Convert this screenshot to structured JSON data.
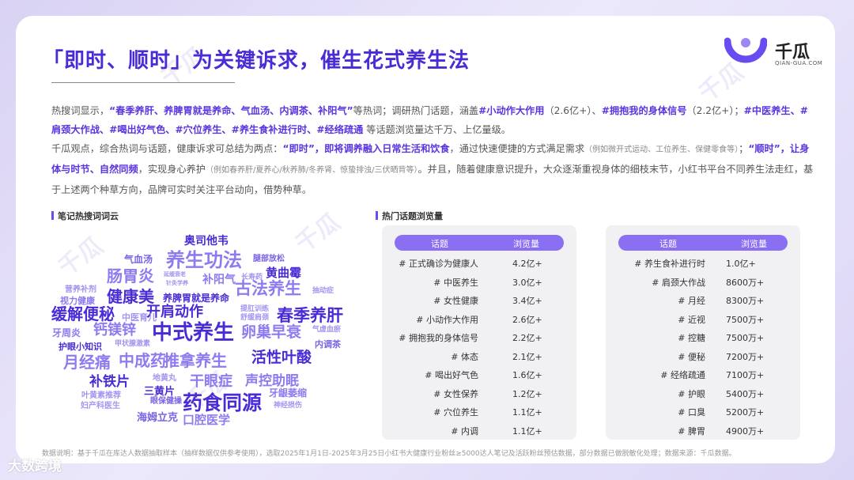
{
  "title": "「即时、顺时」为关键诉求，催生花式养生法",
  "logo": {
    "name": "千瓜",
    "sub": "QIAN-GUA.COM"
  },
  "para1": {
    "s1": "热搜词显示，",
    "s2": "“春季养肝、养脾胃就是养命、气血汤、内调茶、补阳气”",
    "s3": "等热词；调研热门话题，涵盖",
    "s4": "#小动作大作用",
    "s5": "（2.6亿+）、",
    "s6": "#拥抱我的身体信号",
    "s7": "（2.2亿+）；",
    "s8": "#中医养生、#肩颈大作战、#喝出好气色、#穴位养生、#养生食补进行时、#经络疏通",
    "s9": " 等话题浏览量达千万、上亿量级。"
  },
  "para2": {
    "s1": "千瓜观点，综合热词与话题，健康诉求可总结为两点：",
    "s2": "“即时”，即将调养融入日常生活和饮食",
    "s3": "，通过快速便捷的方式满足需求",
    "s4": "（例如微开式运动、工位养生、保健零食等）",
    "s5": "；",
    "s6": "“顺时”，让身体与时节、自然同频",
    "s7": "，实现身心养护",
    "s8": "（例如春养肝/夏养心/秋养肺/冬养肾、惊蛰排浊/三伏晒背等）",
    "s9": "。并且，随着健康意识提升，大众逐渐重视身体的细枝末节，小红书平台不同养生法走红，基于上述两个种草方向，品牌可实时关注平台动向，借势种草。"
  },
  "cloud_label": "笔记热搜词词云",
  "tables_label": "热门话题浏览量",
  "table_headers": {
    "topic": "话题",
    "views": "浏览量"
  },
  "table_left": [
    {
      "topic": "# 正式确诊为健康人",
      "views": "4.2亿+"
    },
    {
      "topic": "# 中医养生",
      "views": "3.0亿+"
    },
    {
      "topic": "# 女性健康",
      "views": "3.4亿+"
    },
    {
      "topic": "# 小动作大作用",
      "views": "2.6亿+"
    },
    {
      "topic": "# 拥抱我的身体信号",
      "views": "2.2亿+"
    },
    {
      "topic": "# 体态",
      "views": "2.1亿+"
    },
    {
      "topic": "# 喝出好气色",
      "views": "1.6亿+"
    },
    {
      "topic": "# 女性保养",
      "views": "1.2亿+"
    },
    {
      "topic": "# 穴位养生",
      "views": "1.1亿+"
    },
    {
      "topic": "# 内调",
      "views": "1.1亿+"
    }
  ],
  "table_right": [
    {
      "topic": "# 养生食补进行时",
      "views": "1.0亿+"
    },
    {
      "topic": "# 肩颈大作战",
      "views": "8600万+"
    },
    {
      "topic": "# 月经",
      "views": "8300万+"
    },
    {
      "topic": "# 近视",
      "views": "7500万+"
    },
    {
      "topic": "# 控糖",
      "views": "7500万+"
    },
    {
      "topic": "# 便秘",
      "views": "7200万+"
    },
    {
      "topic": "# 经络疏通",
      "views": "7100万+"
    },
    {
      "topic": "# 护眼",
      "views": "5400万+"
    },
    {
      "topic": "# 口臭",
      "views": "5200万+"
    },
    {
      "topic": "# 脾胃",
      "views": "4900万+"
    }
  ],
  "word_cloud": [
    {
      "text": "奥司他韦",
      "color": "#4a2bd6",
      "size": 14
    },
    {
      "text": "气血汤",
      "color": "#7b62e6",
      "size": 12
    },
    {
      "text": "养生功法",
      "color": "#8f7af0",
      "size": 24
    },
    {
      "text": "腿部放松",
      "color": "#7b62e6",
      "size": 10
    },
    {
      "text": "肠胃炎",
      "color": "#8f7af0",
      "size": 20
    },
    {
      "text": "黄曲霉",
      "color": "#4a2bd6",
      "size": 15
    },
    {
      "text": "延缓衰老",
      "color": "#a594f0",
      "size": 7
    },
    {
      "text": "针灸学养",
      "color": "#a594f0",
      "size": 7
    },
    {
      "text": "补阳气",
      "color": "#8f7af0",
      "size": 14
    },
    {
      "text": "长寿药",
      "color": "#a594f0",
      "size": 9
    },
    {
      "text": "抽动症",
      "color": "#a594f0",
      "size": 9
    },
    {
      "text": "营养补剂",
      "color": "#a594f0",
      "size": 10
    },
    {
      "text": "视力健康",
      "color": "#8f7af0",
      "size": 11
    },
    {
      "text": "健康美",
      "color": "#4a2bd6",
      "size": 20
    },
    {
      "text": "养脾胃就是养命",
      "color": "#4a2bd6",
      "size": 12
    },
    {
      "text": "古法养生",
      "color": "#8f7af0",
      "size": 21
    },
    {
      "text": "缓解便秘",
      "color": "#4a2bd6",
      "size": 20
    },
    {
      "text": "开肩动作",
      "color": "#4a2bd6",
      "size": 18
    },
    {
      "text": "提肛训练",
      "color": "#a594f0",
      "size": 9
    },
    {
      "text": "舒缓肩颈",
      "color": "#a594f0",
      "size": 9
    },
    {
      "text": "春季养肝",
      "color": "#4a2bd6",
      "size": 21
    },
    {
      "text": "中医育儿",
      "color": "#a594f0",
      "size": 11
    },
    {
      "text": "钙镁锌",
      "color": "#8f7af0",
      "size": 18
    },
    {
      "text": "牙周炎",
      "color": "#8f7af0",
      "size": 12
    },
    {
      "text": "中式养生",
      "color": "#4a2bd6",
      "size": 26
    },
    {
      "text": "卵巢早衰",
      "color": "#8f7af0",
      "size": 19
    },
    {
      "text": "气虚血瘀",
      "color": "#a594f0",
      "size": 9
    },
    {
      "text": "内调茶",
      "color": "#7b62e6",
      "size": 11
    },
    {
      "text": "护眼小知识",
      "color": "#4a2bd6",
      "size": 11
    },
    {
      "text": "甲状腺激素",
      "color": "#a594f0",
      "size": 9
    },
    {
      "text": "月经痛",
      "color": "#8f7af0",
      "size": 20
    },
    {
      "text": "中成药",
      "color": "#8f7af0",
      "size": 20
    },
    {
      "text": "推拿养生",
      "color": "#8f7af0",
      "size": 20
    },
    {
      "text": "活性叶酸",
      "color": "#4a2bd6",
      "size": 19
    },
    {
      "text": "补铁片",
      "color": "#4a2bd6",
      "size": 17
    },
    {
      "text": "地黄丸",
      "color": "#a594f0",
      "size": 10
    },
    {
      "text": "干眼症",
      "color": "#8f7af0",
      "size": 18
    },
    {
      "text": "声控助眠",
      "color": "#8f7af0",
      "size": 17
    },
    {
      "text": "三黄片",
      "color": "#4a2bd6",
      "size": 13
    },
    {
      "text": "叶黄素推荐",
      "color": "#a594f0",
      "size": 10
    },
    {
      "text": "眼保健操",
      "color": "#7b62e6",
      "size": 10
    },
    {
      "text": "牙龈萎缩",
      "color": "#8f7af0",
      "size": 12
    },
    {
      "text": "妇产科医生",
      "color": "#a594f0",
      "size": 10
    },
    {
      "text": "药食同源",
      "color": "#4a2bd6",
      "size": 25
    },
    {
      "text": "神经损伤",
      "color": "#a594f0",
      "size": 9
    },
    {
      "text": "海姆立克",
      "color": "#7b62e6",
      "size": 13
    },
    {
      "text": "口腔医学",
      "color": "#8f7af0",
      "size": 15
    }
  ],
  "footnote": "数据说明：基于千瓜在库达人数据抽取样本（抽样数据仅供参考使用），选取2025年1月1日-2025年3月25日小红书大健康行业粉丝≥5000达人笔记及活跃粉丝预估数据，部分数据已做脱敏化处理；数据来源：千瓜数据。",
  "watermark_text": "千瓜",
  "corner_logo": "大数跨境"
}
